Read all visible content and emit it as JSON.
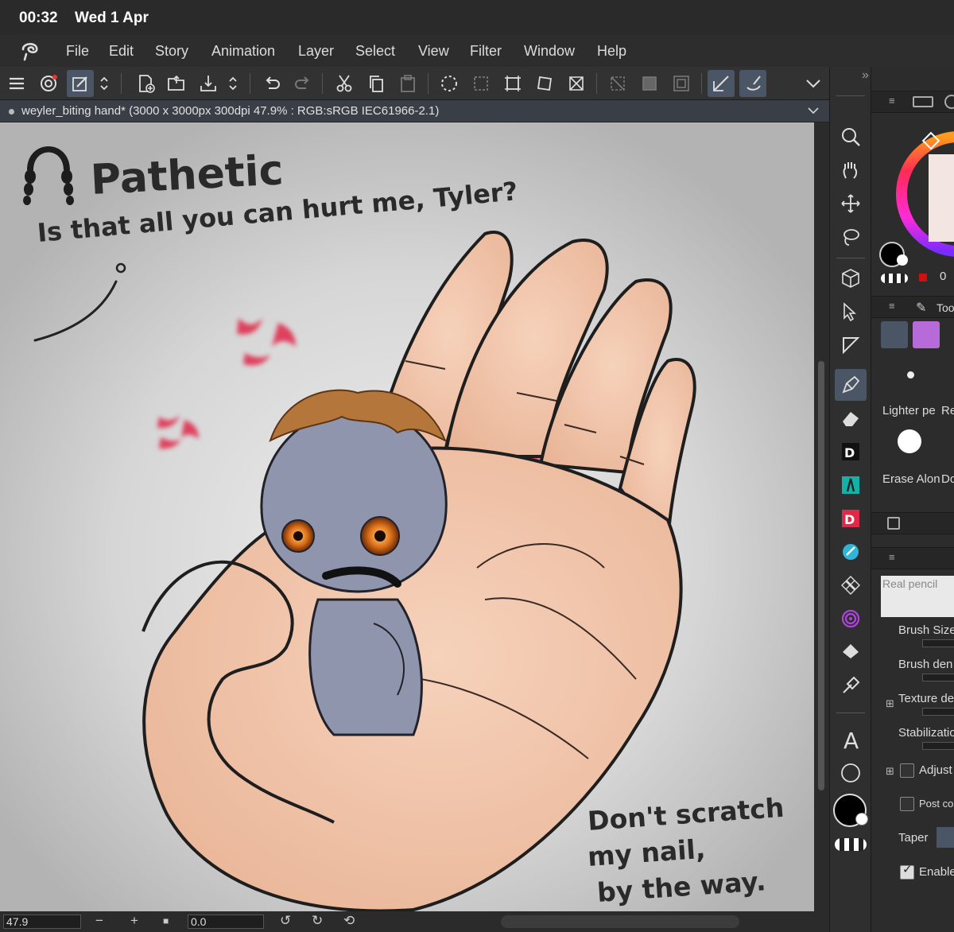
{
  "status": {
    "time": "00:32",
    "date": "Wed 1 Apr"
  },
  "menu": [
    "File",
    "Edit",
    "Story",
    "Animation",
    "Layer",
    "Select",
    "View",
    "Filter",
    "Window",
    "Help"
  ],
  "document": {
    "tab_title": "weyler_biting hand* (3000 x 3000px 300dpi 47.9% : RGB:sRGB IEC61966-2.1)"
  },
  "artwork": {
    "title": "Pathetic",
    "line1": "Is that all you can hurt me, Tyler?",
    "note_line1": "Don't scratch",
    "note_line2": "my nail,",
    "note_line3": "by the way."
  },
  "bottom": {
    "zoom": "47.9",
    "rotation": "0.0"
  },
  "right_panel": {
    "color_value": "0",
    "tool_tab": "Too",
    "sub_tool_1": "Lighter pe",
    "sub_tool_2": "Re",
    "sub_tool_3": "Erase Alon",
    "sub_tool_4": "Do",
    "brush_name": "Real pencil",
    "props": {
      "brush_size": "Brush Size",
      "brush_density": "Brush den",
      "texture": "Texture de",
      "stabilization": "Stabilizatio",
      "adjust": "Adjust",
      "post": "Post corr",
      "taper": "Taper",
      "enable": "Enable"
    }
  },
  "colors": {
    "accent": "#4a5566",
    "skin": "#efc2a6",
    "anger": "#e02848",
    "creature": "#8f95ad",
    "hair": "#b4763a"
  }
}
